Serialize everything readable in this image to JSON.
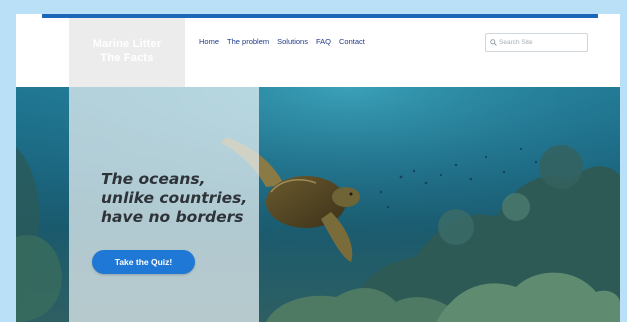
{
  "header": {
    "logo_line1": "Marine Litter",
    "logo_line2": "The Facts"
  },
  "nav": {
    "items": [
      {
        "label": "Home"
      },
      {
        "label": "The problem"
      },
      {
        "label": "Solutions"
      },
      {
        "label": "FAQ"
      },
      {
        "label": "Contact"
      }
    ]
  },
  "search": {
    "placeholder": "Search Site",
    "icon": "search-icon"
  },
  "hero": {
    "headline_lines": [
      "The oceans,",
      "unlike countries,",
      "have no borders"
    ],
    "cta_label": "Take the Quiz!"
  },
  "colors": {
    "accent": "#1f78d6",
    "nav_link": "#1f3a8a",
    "page_background": "#b9e0f7",
    "top_strip": "#1e66b8"
  }
}
